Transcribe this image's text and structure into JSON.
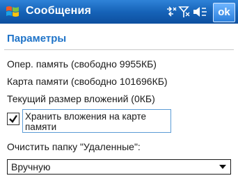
{
  "window": {
    "title": "Сообщения",
    "ok_label": "ok",
    "status_icons": [
      "connectivity-icon",
      "signal-off-icon",
      "volume-muted-icon"
    ]
  },
  "page": {
    "section_title": "Параметры",
    "memory_line": "Опер. память (свободно 9955КБ)",
    "card_line": "Карта памяти (свободно 101696КБ)",
    "attachments_line": "Текущий размер вложений (0КБ)"
  },
  "store_on_card": {
    "label": "Хранить вложения на карте памяти",
    "checked": true
  },
  "empty_deleted": {
    "label": "Очистить папку \"Удаленные\":",
    "value": "Вручную"
  },
  "colors": {
    "title_bar": "#1663b8",
    "section_title": "#1e73c8",
    "focus_border": "#5b9bd5"
  }
}
